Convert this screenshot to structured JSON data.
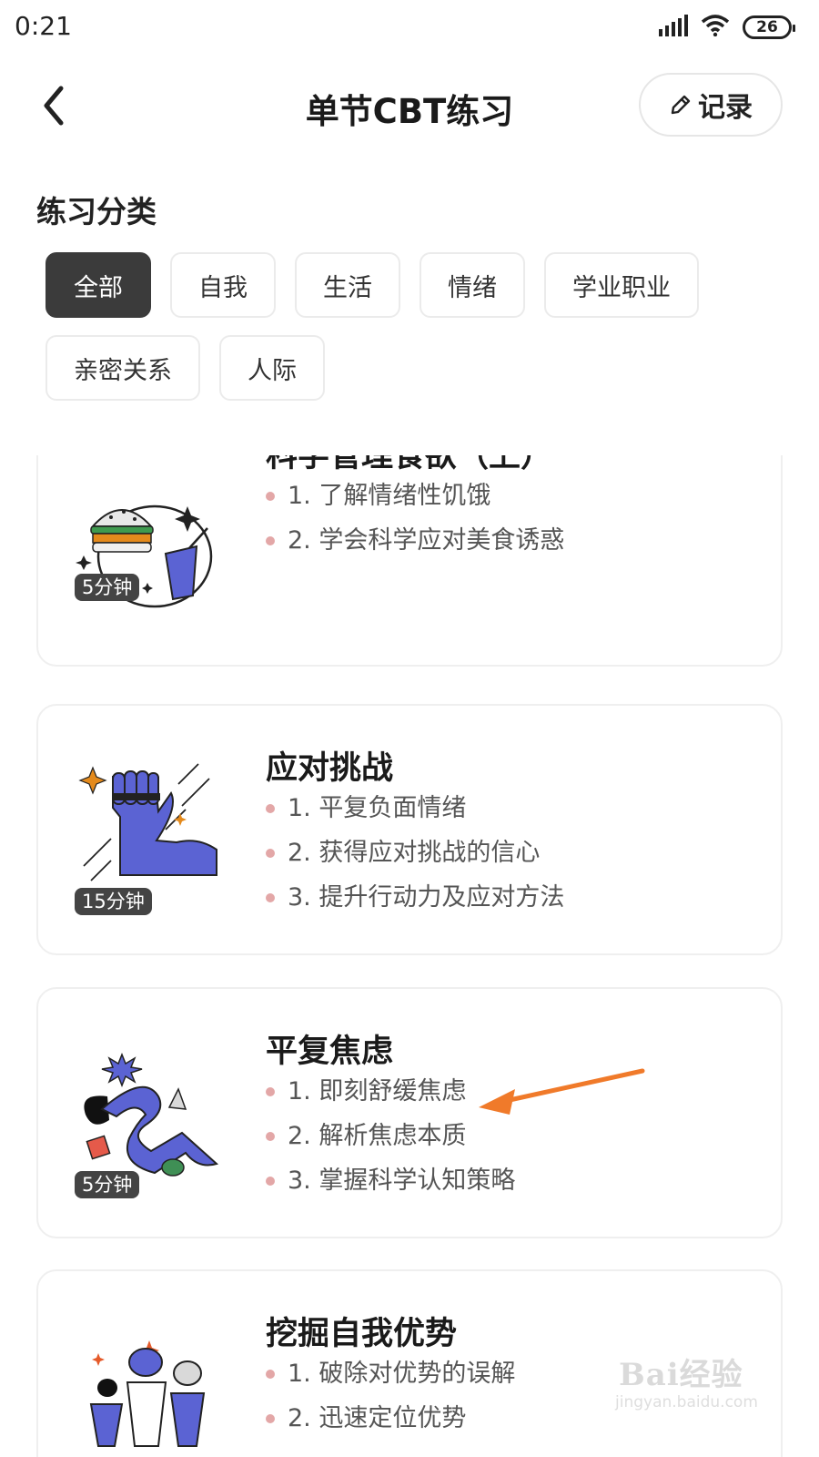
{
  "status_bar": {
    "time": "0:21",
    "battery": "26",
    "icons": [
      "signal-icon",
      "wifi-icon",
      "battery-icon"
    ]
  },
  "nav": {
    "title": "单节CBT练习",
    "record_label": "记录",
    "back_icon": "chevron-left-icon",
    "record_icon": "pencil-icon"
  },
  "categories": {
    "title": "练习分类",
    "chips": [
      {
        "label": "全部",
        "active": true
      },
      {
        "label": "自我",
        "active": false
      },
      {
        "label": "生活",
        "active": false
      },
      {
        "label": "情绪",
        "active": false
      },
      {
        "label": "学业职业",
        "active": false
      },
      {
        "label": "亲密关系",
        "active": false
      },
      {
        "label": "人际",
        "active": false
      }
    ]
  },
  "cards": [
    {
      "title": "科学管理食欲（上）",
      "duration": "5分钟",
      "illustration": "burger-and-drink-illustration",
      "points": [
        "1. 了解情绪性饥饿",
        "2. 学会科学应对美食诱惑"
      ]
    },
    {
      "title": "应对挑战",
      "duration": "15分钟",
      "illustration": "raised-fist-illustration",
      "points": [
        "1. 平复负面情绪",
        "2. 获得应对挑战的信心",
        "3. 提升行动力及应对方法"
      ]
    },
    {
      "title": "平复焦虑",
      "duration": "5分钟",
      "illustration": "anxiety-shapes-illustration",
      "points": [
        "1. 即刻舒缓焦虑",
        "2. 解析焦虑本质",
        "3. 掌握科学认知策略"
      ]
    },
    {
      "title": "挖掘自我优势",
      "duration": "",
      "illustration": "people-figures-illustration",
      "points": [
        "1. 破除对优势的误解",
        "2. 迅速定位优势"
      ]
    }
  ],
  "annotation": {
    "arrow_color": "#f07a2a"
  },
  "watermark": {
    "brand": "Bai经验",
    "url": "jingyan.baidu.com"
  },
  "colors": {
    "accent_purple": "#5b63d3",
    "chip_active_bg": "#3b3b3b",
    "bullet": "#e3a7a7"
  }
}
